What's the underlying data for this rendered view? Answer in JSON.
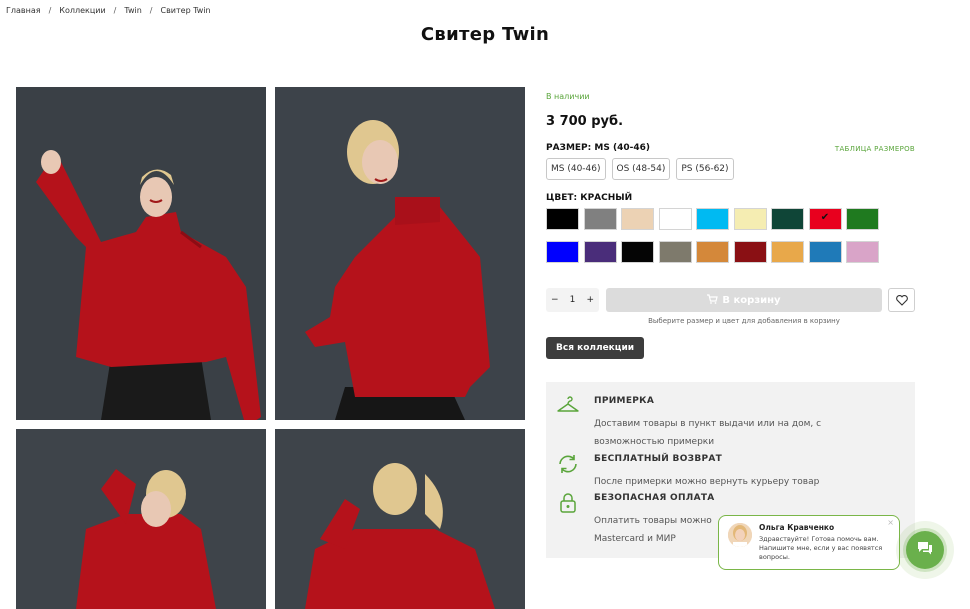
{
  "breadcrumb": {
    "items": [
      "Главная",
      "Коллекции",
      "Twin",
      "Свитер Twin"
    ],
    "separator": "/"
  },
  "product": {
    "title": "Свитер Twin",
    "stock": "В наличии",
    "price": "3 700 руб.",
    "size_label": "Размер: MS (40-46)",
    "size_chart": "Таблица размеров",
    "sizes": [
      "MS (40-46)",
      "OS (48-54)",
      "PS (56-62)"
    ],
    "color_label": "Цвет: Красный",
    "colors_row1": [
      "#000000",
      "#808080",
      "#ecd2b4",
      "#ffffff",
      "#00baf2",
      "#f5edb2",
      "#0f4537",
      "#e8001e",
      "#1f7a1f"
    ],
    "colors_row2": [
      "#0000ff",
      "#4a2d7a",
      "#050505",
      "#7e7a6c",
      "#d4883a",
      "#8a1014",
      "#e8a84a",
      "#1f7ab8",
      "#d9a4c8"
    ],
    "selected_color_check": "✔",
    "qty_minus": "−",
    "qty_value": "1",
    "qty_plus": "+",
    "cart_button": "В корзину",
    "hint": "Выберите размер и цвет для добавления в корзину",
    "collections_button": "Вся коллекции"
  },
  "benefits": [
    {
      "icon": "hanger-icon",
      "title": "Примерка",
      "desc": "Доставим товары в пункт выдачи или на дом, с возможностью примерки"
    },
    {
      "icon": "return-icon",
      "title": "Бесплатный возврат",
      "desc": "После примерки можно вернуть курьеру товар"
    },
    {
      "icon": "lock-icon",
      "title": "Безопасная оплата",
      "desc": "Оплатить товары можно\nMastercard и МИР"
    }
  ],
  "chat": {
    "name": "Ольга Кравченко",
    "message": "Здравствуйте! Готова помочь вам. Напишите мне, если у вас появятся вопросы.",
    "close": "×"
  },
  "accent_color": "#6ab04c"
}
